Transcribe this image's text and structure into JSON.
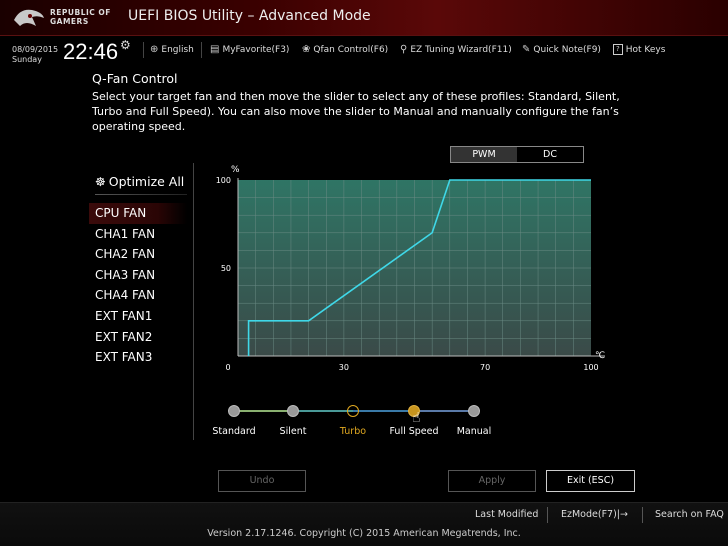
{
  "header": {
    "brand_line1": "REPUBLIC OF",
    "brand_line2": "GAMERS",
    "title": "UEFI BIOS Utility – Advanced Mode"
  },
  "infobar": {
    "date": "08/09/2015",
    "day": "Sunday",
    "time": "22:46",
    "items": [
      {
        "icon": "globe-icon",
        "glyph": "⊕",
        "label": "English"
      },
      {
        "icon": "favorite-icon",
        "glyph": "▤",
        "label": "MyFavorite(F3)"
      },
      {
        "icon": "fan-icon",
        "glyph": "❀",
        "label": "Qfan Control(F6)"
      },
      {
        "icon": "bulb-icon",
        "glyph": "♀",
        "label": "EZ Tuning Wizard(F11)"
      },
      {
        "icon": "note-icon",
        "glyph": "✎",
        "label": "Quick Note(F9)"
      },
      {
        "icon": "hotkey-icon",
        "glyph": "?",
        "label": "Hot Keys"
      }
    ]
  },
  "page": {
    "title": "Q-Fan Control",
    "description": "Select your target fan and then move the slider to select any of these profiles: Standard, Silent, Turbo and Full Speed). You can also move the slider to Manual and manually configure the fan’s operating speed."
  },
  "fans": {
    "optimize_label": "Optimize All",
    "selected": 0,
    "items": [
      "CPU FAN",
      "CHA1 FAN",
      "CHA2 FAN",
      "CHA3 FAN",
      "CHA4 FAN",
      "EXT FAN1",
      "EXT FAN2",
      "EXT FAN3"
    ]
  },
  "mode_toggle": {
    "options": [
      "PWM",
      "DC"
    ],
    "selected": "PWM"
  },
  "chart_data": {
    "type": "line",
    "title": "",
    "xlabel": "℃",
    "ylabel": "%",
    "xlim": [
      0,
      100
    ],
    "ylim": [
      0,
      100
    ],
    "x_ticks": [
      0,
      30,
      70,
      100
    ],
    "y_ticks": [
      50,
      100
    ],
    "grid": true,
    "series": [
      {
        "name": "CPU FAN",
        "color": "#3fd8e8",
        "x": [
          3,
          3,
          20,
          55,
          60,
          100
        ],
        "y": [
          0,
          20,
          20,
          70,
          100,
          100
        ]
      }
    ]
  },
  "profiles": {
    "items": [
      "Standard",
      "Silent",
      "Turbo",
      "Full Speed",
      "Manual"
    ],
    "selected": "Turbo",
    "hover": "Full Speed"
  },
  "buttons": {
    "undo": "Undo",
    "apply": "Apply",
    "exit": "Exit (ESC)"
  },
  "footer": {
    "last_modified": "Last Modified",
    "ezmode": "EzMode(F7)|→",
    "search": "Search on FAQ",
    "version": "Version 2.17.1246. Copyright (C) 2015 American Megatrends, Inc."
  },
  "colors": {
    "accent": "#e0a820",
    "curve": "#3fd8e8",
    "chart_fill": "#2d6e60"
  }
}
